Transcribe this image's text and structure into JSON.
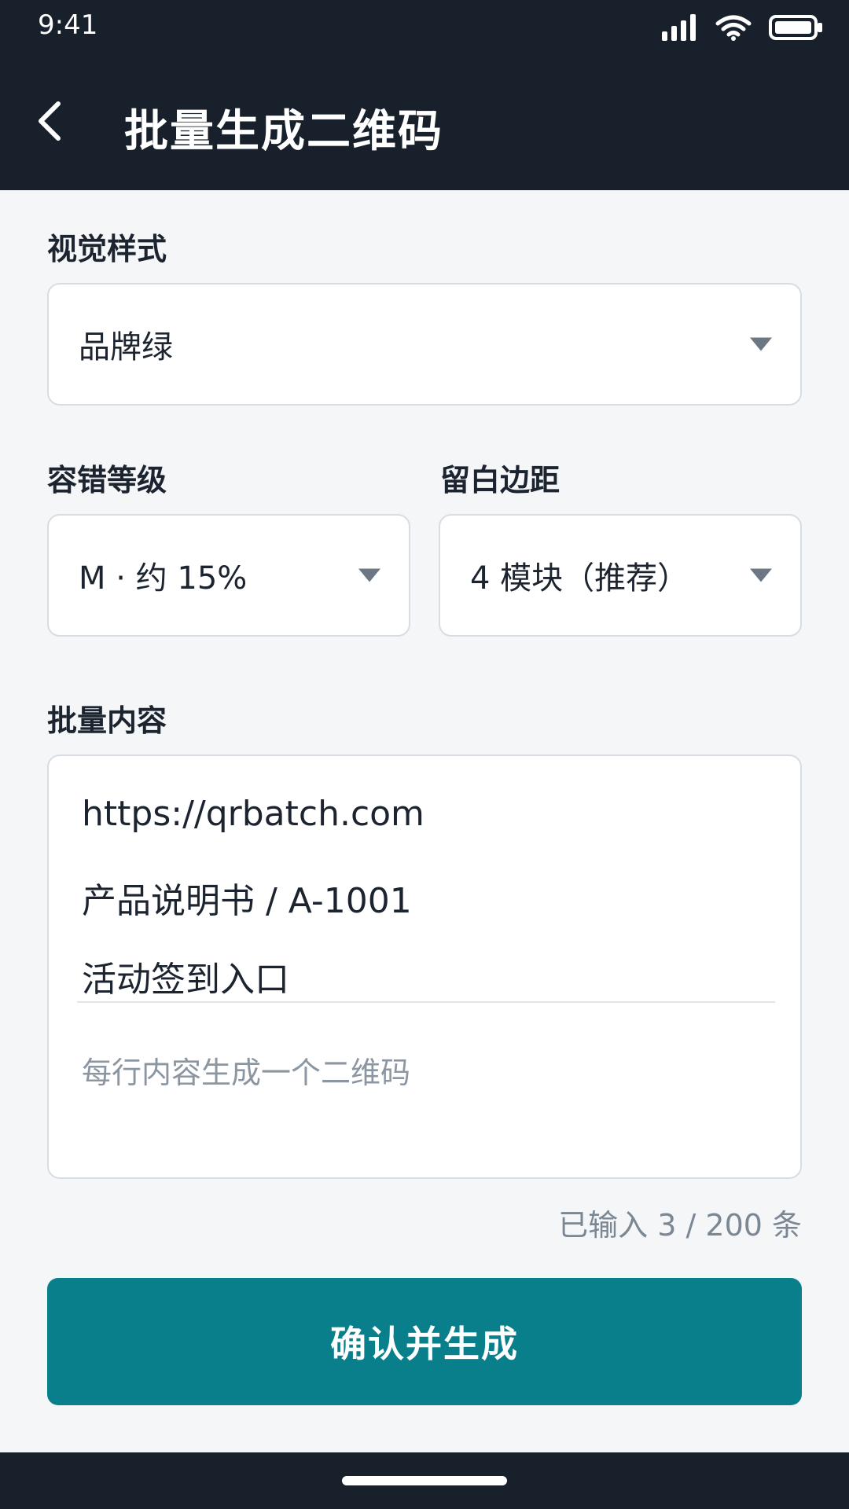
{
  "status_bar": {
    "time": "9:41",
    "icons": [
      "signal-icon",
      "wifi-icon",
      "battery-icon"
    ]
  },
  "header": {
    "title": "批量生成二维码",
    "back_icon": "chevron-left-icon"
  },
  "form": {
    "visual_style": {
      "label": "视觉样式",
      "value": "品牌绿"
    },
    "error_correction": {
      "label": "容错等级",
      "value": "M ·  约 15%"
    },
    "margin": {
      "label": "留白边距",
      "value": "4 模块（推荐）"
    },
    "batch_content": {
      "label": "批量内容",
      "lines": [
        "https://qrbatch.com",
        "产品说明书 / A-1001",
        "活动签到入口"
      ],
      "placeholder": "每行内容生成一个二维码"
    },
    "counter": "已输入 3 / 200 条"
  },
  "actions": {
    "confirm_label": "确认并生成"
  },
  "colors": {
    "header_bg": "#17202b",
    "page_bg": "#f4f6f8",
    "primary": "#087f8a",
    "border": "#d7dde3",
    "muted_text": "#7b8792"
  }
}
